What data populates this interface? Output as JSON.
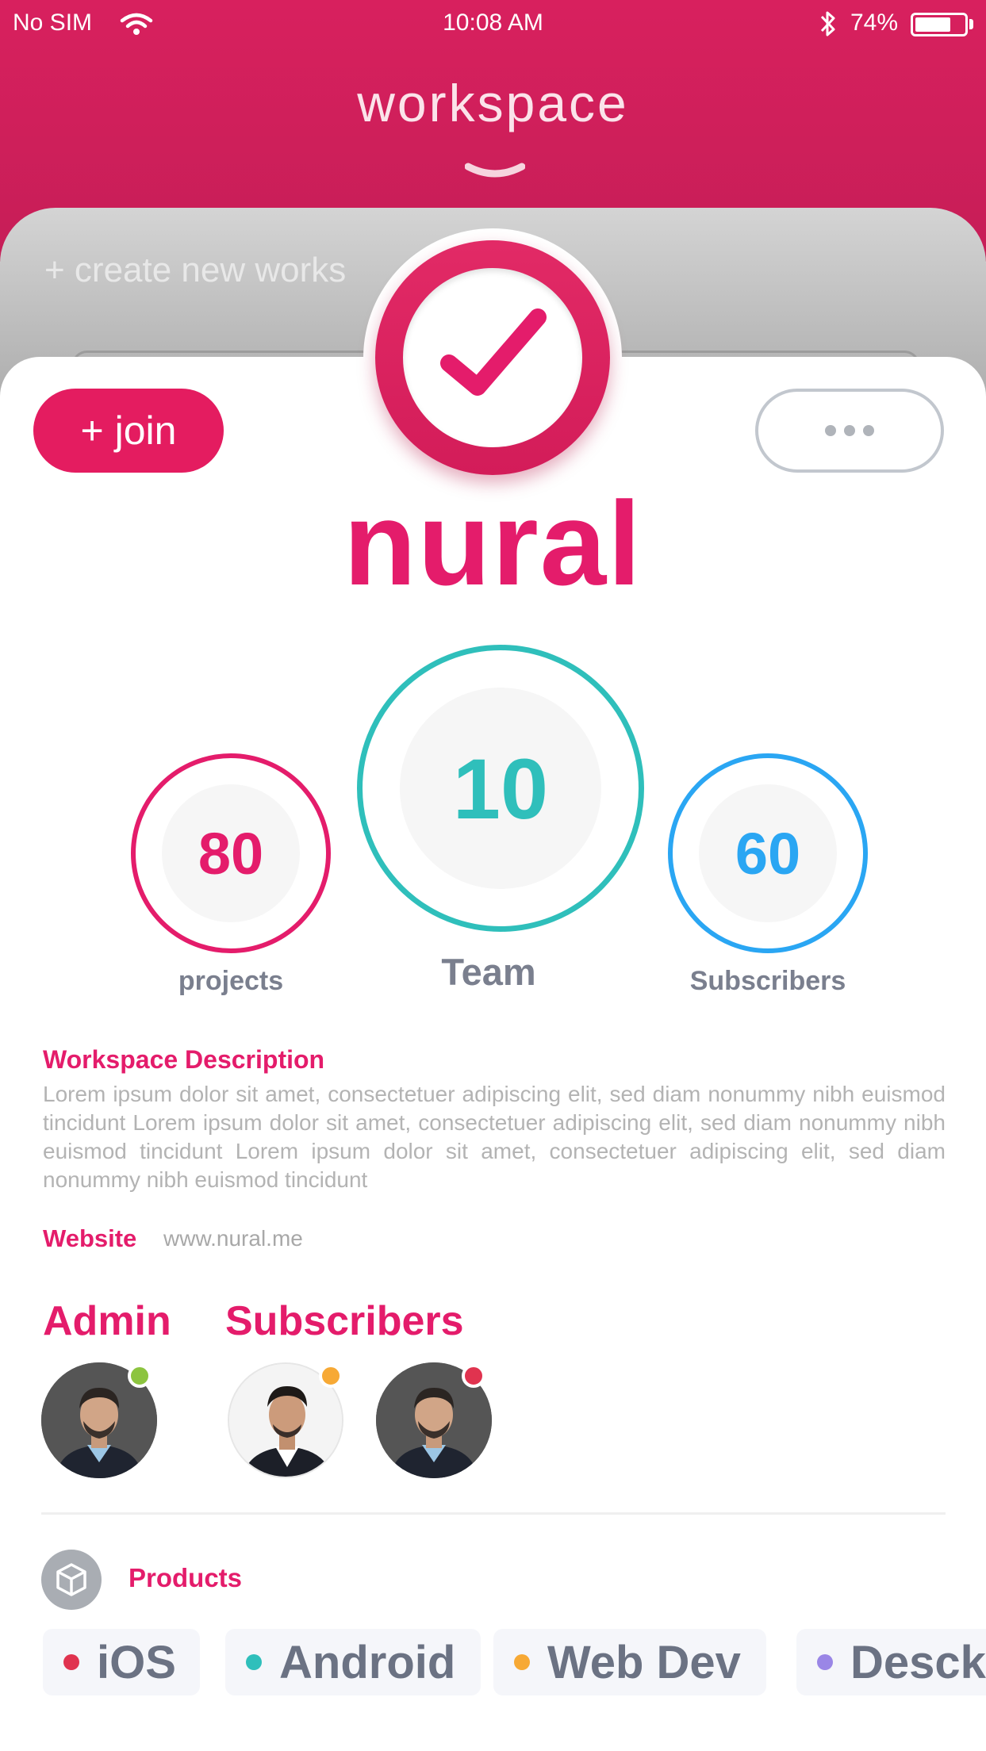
{
  "status_bar": {
    "carrier": "No SIM",
    "time": "10:08 AM",
    "battery_percent": "74%",
    "battery_level": 0.74
  },
  "header": {
    "title": "workspace"
  },
  "back_card": {
    "create_label": "+ create new works"
  },
  "actions": {
    "join_label": "+ join"
  },
  "workspace": {
    "name": "nural"
  },
  "stats": {
    "projects": {
      "value": "80",
      "label": "projects",
      "color": "#e41c6b"
    },
    "team": {
      "value": "10",
      "label": "Team",
      "color": "#2fbfbb"
    },
    "subscribers": {
      "value": "60",
      "label": "Subscribers",
      "color": "#2aa6f3"
    }
  },
  "description": {
    "title": "Workspace Description",
    "text": "Lorem ipsum dolor sit amet, consectetuer adipiscing elit, sed diam nonummy nibh euismod tincidunt Lorem ipsum dolor sit amet, consectetuer adipiscing elit, sed diam nonummy nibh euismod tincidunt Lorem ipsum dolor sit amet, consectetuer adipiscing elit, sed diam nonummy nibh euismod tincidunt"
  },
  "website": {
    "label": "Website",
    "value": "www.nural.me"
  },
  "people": {
    "admin_title": "Admin",
    "subscribers_title": "Subscribers",
    "status_colors": {
      "admin": "#8cc43f",
      "subscriber_1": "#f7a935",
      "subscriber_2": "#e0334f"
    }
  },
  "products": {
    "title": "Products",
    "tags": [
      {
        "label": "iOS",
        "color": "#e0334f"
      },
      {
        "label": "Android",
        "color": "#2fbfbb"
      },
      {
        "label": "Web Dev",
        "color": "#f7a935"
      },
      {
        "label": "Desck",
        "color": "#9a86e6"
      }
    ]
  },
  "colors": {
    "brand": "#e41c6b",
    "header": "#d6205e"
  }
}
